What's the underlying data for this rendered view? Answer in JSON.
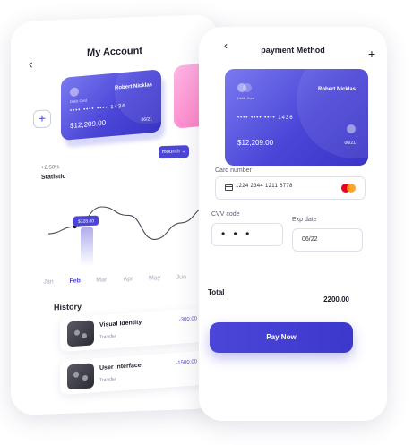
{
  "left_screen": {
    "back_icon": "chevron-left-icon",
    "title": "My Account",
    "add_icon": "plus-icon",
    "card": {
      "type_label": "Debit Card",
      "holder": "Robert Nicklas",
      "number_masked": "••••  ••••  ••••  1436",
      "last4": "1436",
      "balance": "$12,209.00",
      "expiry": "06/21"
    },
    "statistic": {
      "change": "+2.50%",
      "label": "Statistic",
      "period": "mounth",
      "tooltip": "$328.00"
    },
    "chart_data": {
      "type": "line",
      "categories": [
        "Jan",
        "Feb",
        "Mar",
        "Apr",
        "May",
        "Jun",
        "Jul"
      ],
      "highlighted": "Feb",
      "values": [
        0.45,
        0.55,
        0.85,
        0.7,
        0.3,
        0.55,
        0.8
      ]
    },
    "history": {
      "title": "History",
      "items": [
        {
          "name": "Visual Identity",
          "sub": "Transfer",
          "amount": "-300.00"
        },
        {
          "name": "User Interface",
          "sub": "Transfer",
          "amount": "-1500.00"
        }
      ]
    }
  },
  "right_screen": {
    "back_icon": "chevron-left-icon",
    "title": "payment Method",
    "plus_icon": "plus-icon",
    "card": {
      "type_label": "Debit Card",
      "holder": "Robert Nicklas",
      "number_masked": "••••  ••••  ••••  1436",
      "last4": "1436",
      "balance": "$12,209.00",
      "expiry": "06/21"
    },
    "card_number_label": "Card number",
    "card_number_value": "1224 2344 1211 6778",
    "cvv_label": "CVV code",
    "cvv_value": "• • •",
    "exp_label": "Exp date",
    "exp_value": "06/22",
    "total_label": "Total",
    "total_value": "2200.00",
    "pay_button": "Pay Now"
  },
  "colors": {
    "accent": "#4b46d8",
    "pink_card": "#ff7fc6"
  }
}
